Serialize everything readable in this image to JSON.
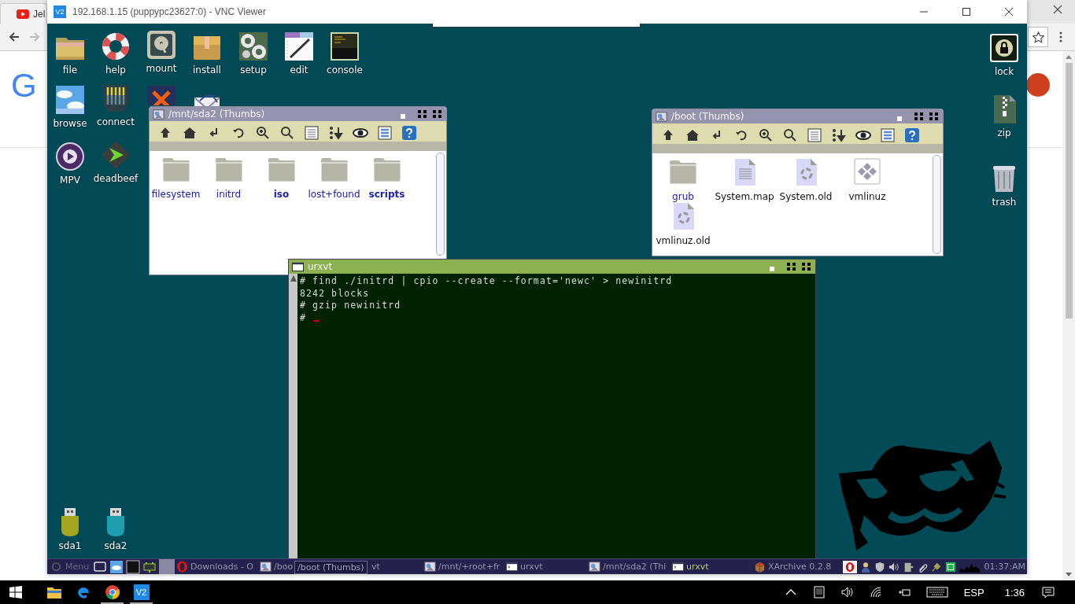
{
  "browser": {
    "tab_title": "Jel",
    "logo": "G"
  },
  "vnc": {
    "logo": "V2",
    "title": "192.168.1.15 (puppypc23627:0) - VNC Viewer"
  },
  "desktop_icons": [
    {
      "label": "file",
      "kind": "folder"
    },
    {
      "label": "help",
      "kind": "lifebuoy"
    },
    {
      "label": "mount",
      "kind": "drive"
    },
    {
      "label": "install",
      "kind": "box"
    },
    {
      "label": "setup",
      "kind": "gears"
    },
    {
      "label": "edit",
      "kind": "notepad"
    },
    {
      "label": "console",
      "kind": "console"
    },
    {
      "label": "browse",
      "kind": "sky"
    },
    {
      "label": "connect",
      "kind": "jack"
    },
    {
      "kind": "cross"
    },
    {
      "kind": "mail"
    },
    {
      "label": "MPV",
      "kind": "player"
    },
    {
      "label": "deadbeef",
      "kind": "diamond"
    },
    {
      "label": "sda1",
      "kind": "usb",
      "color": "#a4a41e"
    },
    {
      "label": "sda2",
      "kind": "usb",
      "color": "#1e9fb0"
    },
    {
      "label": "lock",
      "kind": "lock"
    },
    {
      "label": "zip",
      "kind": "zip"
    },
    {
      "label": "trash",
      "kind": "trash"
    }
  ],
  "file_windows": [
    {
      "title": "/mnt/sda2 (Thumbs)",
      "items": [
        {
          "name": "filesystem",
          "kind": "folder",
          "bold": false
        },
        {
          "name": "initrd",
          "kind": "folder",
          "bold": false
        },
        {
          "name": "iso",
          "kind": "folder",
          "bold": true
        },
        {
          "name": "lost+found",
          "kind": "folder",
          "bold": false
        },
        {
          "name": "scripts",
          "kind": "folder",
          "bold": true
        }
      ]
    },
    {
      "title": "/boot (Thumbs)",
      "items": [
        {
          "name": "grub",
          "kind": "folder",
          "bold": false
        },
        {
          "name": "System.map",
          "kind": "text",
          "bold": false
        },
        {
          "name": "System.old",
          "kind": "recycle",
          "bold": false
        },
        {
          "name": "vmlinuz",
          "kind": "package",
          "bold": false
        },
        {
          "name": "vmlinuz.old",
          "kind": "recycle",
          "bold": false
        }
      ]
    }
  ],
  "terminal": {
    "title": "urxvt",
    "lines": [
      "# find ./initrd | cpio --create --format='newc' > newinitrd",
      "8242 blocks",
      "# gzip newinitrd",
      "#"
    ],
    "cursor": true
  },
  "taskbar": {
    "menu": "Menu",
    "tasks": [
      {
        "kind": "opera",
        "label": "Downloads - O",
        "active": false
      },
      {
        "kind": "filer",
        "label": "/boo",
        "active": false
      },
      {
        "kind": "fragment",
        "label": "vt",
        "active": false
      },
      {
        "kind": "filer",
        "label": "/mnt/+root+fr",
        "active": false
      },
      {
        "kind": "terminal",
        "label": "urxvt",
        "active": false
      },
      {
        "kind": "filer",
        "label": "/mnt/sda2 (Thi",
        "active": false
      },
      {
        "kind": "terminal",
        "label": "urxvt",
        "active": true
      },
      {
        "kind": "archive",
        "label": "XArchive 0.2.8",
        "active": false
      }
    ],
    "tooltip": "/boot (Thumbs)",
    "clock": "01:37:AM"
  },
  "windows_taskbar": {
    "apps": [
      {
        "kind": "explorer",
        "running": false
      },
      {
        "kind": "edge",
        "running": false
      },
      {
        "kind": "chrome",
        "running": true
      },
      {
        "kind": "vnc",
        "text": "V2",
        "running": true
      }
    ],
    "language": "ESP",
    "time": "1:36"
  }
}
